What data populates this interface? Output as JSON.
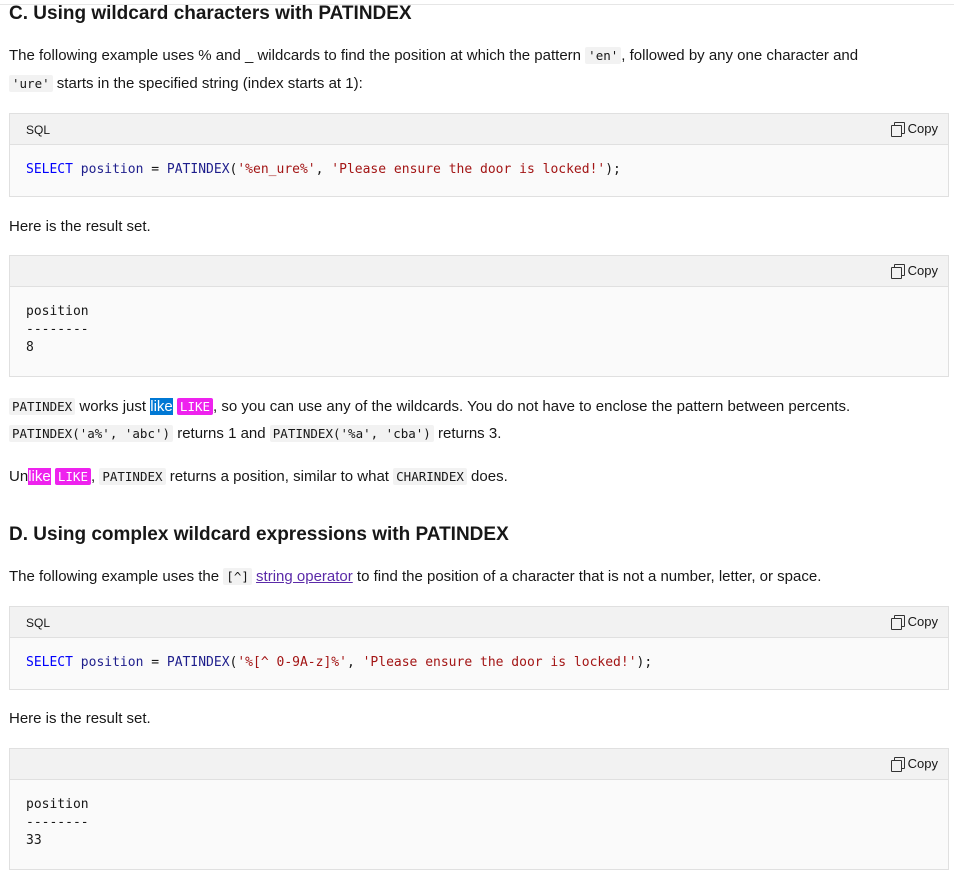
{
  "sectionC": {
    "heading": "C. Using wildcard characters with PATINDEX",
    "intro": {
      "t1": "The following example uses % and _ wildcards to find the position at which the pattern ",
      "c1": "'en'",
      "t2": ", followed by any one character and",
      "c2": "'ure'",
      "t3": " starts in the specified string (index starts at 1):"
    },
    "code1": {
      "lang": "SQL",
      "copy": "Copy",
      "kw": "SELECT",
      "ident": "position",
      "eq": " = ",
      "fn": "PATINDEX",
      "open": "(",
      "arg1": "'%en_ure%'",
      "comma": ", ",
      "arg2": "'Please ensure the door is locked!'",
      "close": ");"
    },
    "result_intro": "Here is the result set.",
    "result": {
      "copy": "Copy",
      "header": "position",
      "divider": "--------",
      "value": "8"
    },
    "note1": {
      "c1": "PATINDEX",
      "t1": " works just ",
      "hl_word": "like",
      "sp": " ",
      "c2": "LIKE",
      "t2": ", so you can use any of the wildcards. You do not have to enclose the pattern between percents.",
      "c3": "PATINDEX('a%', 'abc')",
      "t3": " returns 1 and ",
      "c4": "PATINDEX('%a', 'cba')",
      "t4": " returns 3."
    },
    "note2": {
      "t1": "Un",
      "hl": "like",
      "sp": " ",
      "c1": "LIKE",
      "t2": ", ",
      "c2": "PATINDEX",
      "t3": " returns a position, similar to what ",
      "c3": "CHARINDEX",
      "t4": " does."
    }
  },
  "sectionD": {
    "heading": "D. Using complex wildcard expressions with PATINDEX",
    "intro": {
      "t1": "The following example uses the ",
      "c1": "[^]",
      "sp": " ",
      "link": "string operator",
      "t2": " to find the position of a character that is not a number, letter, or space."
    },
    "code2": {
      "lang": "SQL",
      "copy": "Copy",
      "kw": "SELECT",
      "ident": "position",
      "eq": " = ",
      "fn": "PATINDEX",
      "open": "(",
      "arg1": "'%[^ 0-9A-z]%'",
      "comma": ", ",
      "arg2": "'Please ensure the door is locked!'",
      "close": ");"
    },
    "result_intro": "Here is the result set.",
    "result": {
      "copy": "Copy",
      "header": "position",
      "divider": "--------",
      "value": "33"
    }
  },
  "colors": {
    "keyword": "#0101fd",
    "string": "#a31515",
    "selection_highlight": "#0078d4",
    "find_highlight": "#ee22ee",
    "link": "#5b2aa8"
  }
}
